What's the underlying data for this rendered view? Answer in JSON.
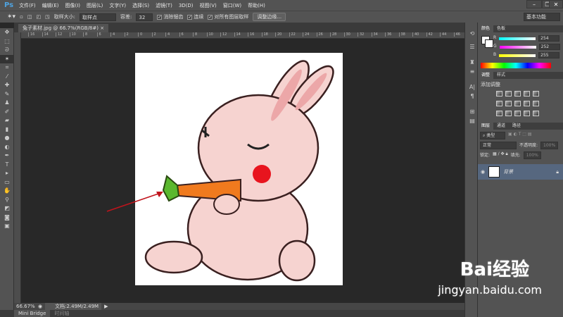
{
  "app": {
    "logo": "Ps"
  },
  "menu": [
    "文件(F)",
    "编辑(E)",
    "图像(I)",
    "图层(L)",
    "文字(Y)",
    "选择(S)",
    "滤镜(T)",
    "3D(D)",
    "视图(V)",
    "窗口(W)",
    "帮助(H)"
  ],
  "window_controls": {
    "minimize": "–",
    "restore": "❐",
    "close": "✕"
  },
  "options": {
    "sample_size_label": "取样大小:",
    "sample_size_value": "取样点",
    "tolerance_label": "容差:",
    "tolerance_value": "32",
    "antialias_label": "消除锯齿",
    "contiguous_label": "连续",
    "sample_all_label": "对所有图层取样",
    "refine_edge_button": "调整边缘...",
    "workspace": "基本功能"
  },
  "document": {
    "tab_title": "兔子素材.jpg @ 66.7%(RGB/8#)",
    "close": "×"
  },
  "ruler_ticks": [
    "16",
    "14",
    "12",
    "10",
    "8",
    "6",
    "4",
    "2",
    "0",
    "2",
    "4",
    "6",
    "8",
    "10",
    "12",
    "14",
    "16",
    "18",
    "20",
    "22",
    "24",
    "26",
    "28",
    "30",
    "32",
    "34",
    "36",
    "38",
    "40",
    "42",
    "44",
    "46"
  ],
  "status": {
    "zoom": "66.67%",
    "doc_info": "文档:2.49M/2.49M"
  },
  "bottom_tabs": [
    "Mini Bridge",
    "时间轴"
  ],
  "color_panel": {
    "tabs": [
      "颜色",
      "色板"
    ],
    "channels": [
      {
        "label": "R",
        "value": "254"
      },
      {
        "label": "G",
        "value": "252"
      },
      {
        "label": "B",
        "value": "255"
      }
    ]
  },
  "adjust_panel": {
    "tabs": [
      "调整",
      "样式"
    ],
    "title": "添加调整"
  },
  "layers_panel": {
    "tabs": [
      "图层",
      "通道",
      "路径"
    ],
    "filter": "类型",
    "blend_mode": "正常",
    "opacity_label": "不透明度:",
    "opacity_value": "100%",
    "lock_label": "锁定:",
    "fill_label": "填充:",
    "fill_value": "100%",
    "layers": [
      {
        "name": "背景"
      }
    ]
  },
  "watermark": {
    "brand": "Bai经验",
    "url": "jingyan.baidu.com"
  },
  "colors": {
    "arrow": "#c0141c",
    "carrot": "#f07a1e"
  }
}
